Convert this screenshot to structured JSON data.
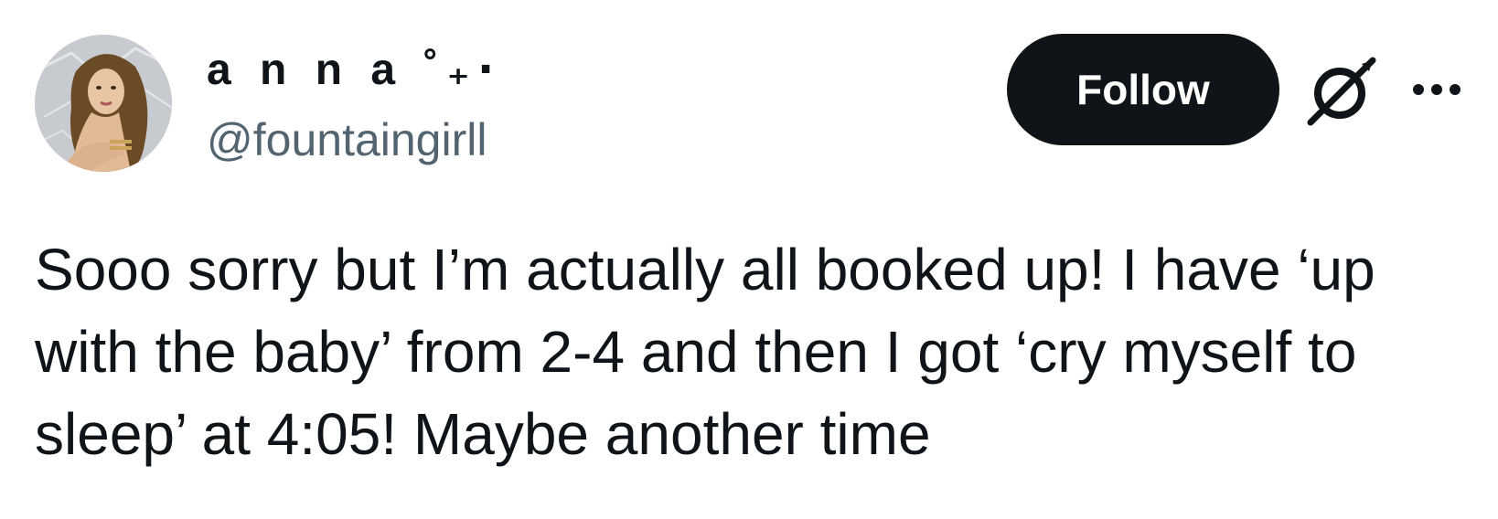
{
  "author": {
    "display_name": "a n n a ˚₊‧",
    "handle": "@fountaingirll",
    "avatar_icon": "avatar-photo"
  },
  "actions": {
    "follow_label": "Follow",
    "grok_icon": "grok-icon",
    "more_icon": "more-options-icon"
  },
  "tweet": {
    "text": "Sooo sorry but I’m actually all booked up! I have ‘up with the baby’ from 2-4 and then I got ‘cry myself to sleep’ at 4:05! Maybe another time"
  },
  "colors": {
    "text_primary": "#0f1419",
    "text_secondary": "#536471",
    "button_bg": "#0f1419",
    "button_text": "#ffffff"
  }
}
